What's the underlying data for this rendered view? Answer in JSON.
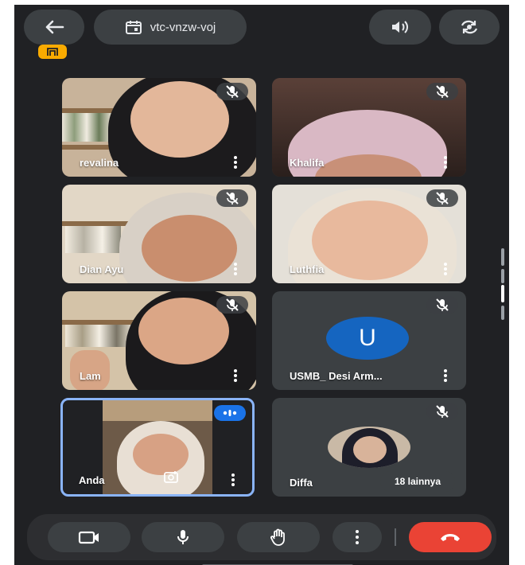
{
  "header": {
    "meeting_code": "vtc-vnzw-voj"
  },
  "participants": [
    {
      "name": "revalina"
    },
    {
      "name": "Khalifa"
    },
    {
      "name": "Dian Ayu"
    },
    {
      "name": "Luthfia"
    },
    {
      "name": "Lam"
    },
    {
      "name": "USMB_ Desi Arm..."
    },
    {
      "name": "Anda"
    },
    {
      "name": "Diffa"
    }
  ],
  "avatar_letter": "U",
  "others_count_label": "18 lainnya",
  "colors": {
    "background": "#202124",
    "tile": "#3c4043",
    "accent_blue": "#1565c0",
    "end_call": "#ea4335",
    "indicator": "#f9ab00",
    "active_border": "#8ab4f8"
  },
  "icons": [
    "back-arrow-icon",
    "calendar-icon",
    "speaker-icon",
    "switch-camera-icon",
    "meeting-indicator-icon",
    "mic-off-icon",
    "more-vert-icon",
    "camera-icon",
    "mic-icon",
    "raise-hand-icon",
    "end-call-icon",
    "speaking-icon",
    "camera-switch-small-icon"
  ]
}
